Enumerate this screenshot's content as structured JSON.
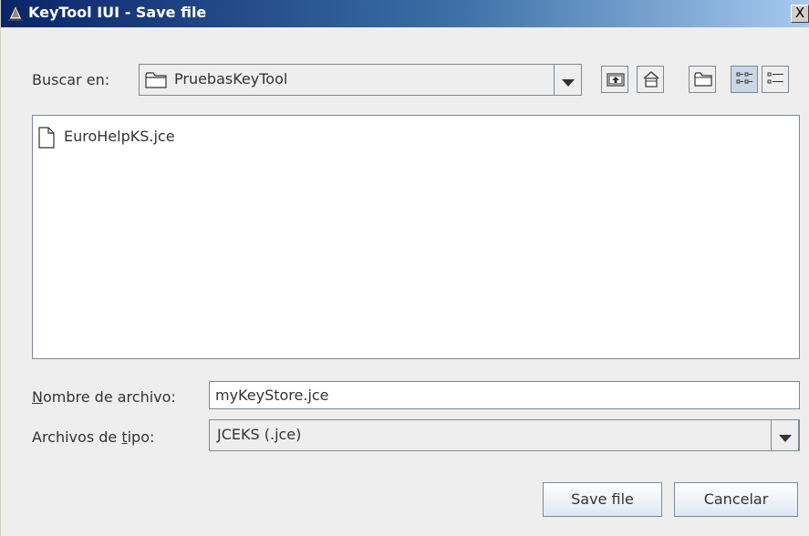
{
  "window": {
    "title": "KeyTool IUI - Save file",
    "close_symbol": "X"
  },
  "look_in": {
    "label": "Buscar en:",
    "value": "PruebasKeyTool",
    "icon": "folder-icon"
  },
  "toolbar": {
    "buttons": [
      {
        "name": "up-one-level-button",
        "icon": "up-folder-icon"
      },
      {
        "name": "home-button",
        "icon": "home-icon"
      },
      {
        "name": "new-folder-button",
        "icon": "new-folder-icon"
      },
      {
        "name": "list-view-button",
        "icon": "list-view-icon",
        "selected": true
      },
      {
        "name": "details-view-button",
        "icon": "details-view-icon",
        "selected": false
      }
    ]
  },
  "files": [
    {
      "name": "EuroHelpKS.jce",
      "icon": "file-icon"
    }
  ],
  "file_name": {
    "label_first": "N",
    "label_rest": "ombre de archivo:",
    "value": "myKeyStore.jce"
  },
  "file_type": {
    "label_before": "Archivos de ",
    "label_mnemonic": "t",
    "label_after": "ipo:",
    "value": "JCEKS (.jce)"
  },
  "actions": {
    "save_label": "Save file",
    "cancel_label": "Cancelar"
  },
  "colors": {
    "titlebar_start": "#0a246a",
    "titlebar_end": "#a6caf0",
    "panel_bg": "#eeeeee",
    "border": "#7a8a99",
    "selected_toggle": "#c8d6e5"
  }
}
